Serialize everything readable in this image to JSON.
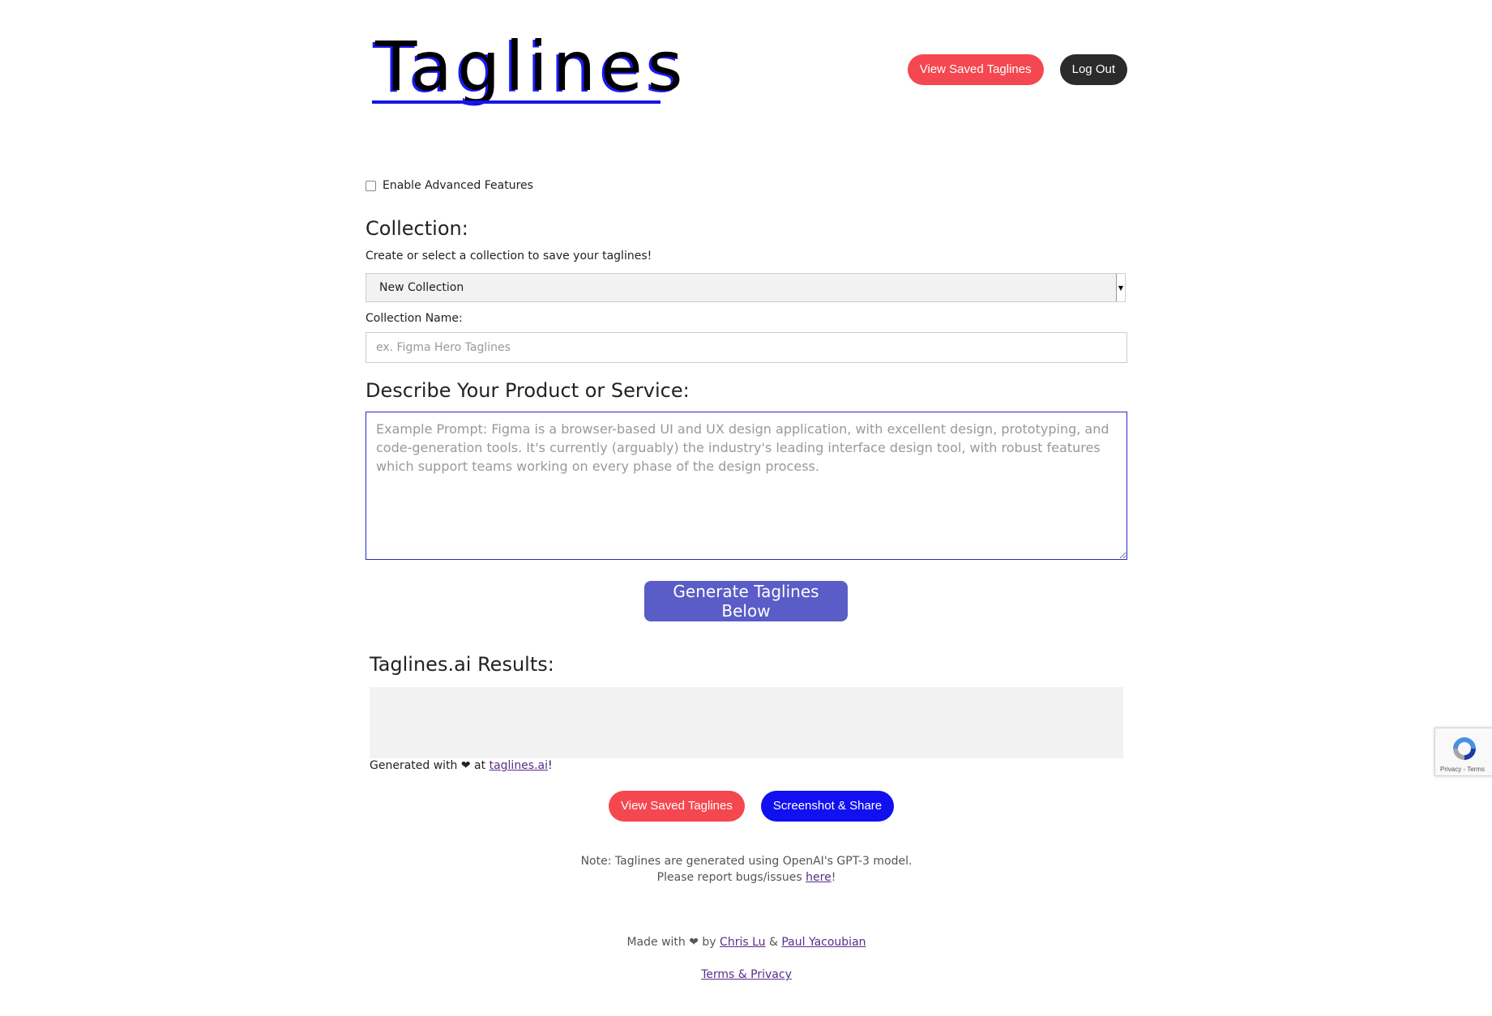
{
  "header": {
    "logo_text": "Taglines",
    "view_saved_label": "View Saved Taglines",
    "logout_label": "Log Out"
  },
  "advanced": {
    "label": "Enable Advanced Features"
  },
  "collection": {
    "title": "Collection:",
    "help": "Create or select a collection to save your taglines!",
    "selected": "New Collection",
    "name_label": "Collection Name:",
    "name_placeholder": "ex. Figma Hero Taglines"
  },
  "describe": {
    "title": "Describe Your Product or Service:",
    "placeholder": "Example Prompt: Figma is a browser-based UI and UX design application, with excellent design, prototyping, and code-generation tools. It's currently (arguably) the industry's leading interface design tool, with robust features which support teams working on every phase of the design process."
  },
  "generate_label": "Generate Taglines Below",
  "results": {
    "title": "Taglines.ai Results:",
    "generated_prefix": "Generated with ❤ at ",
    "generated_link": "taglines.ai",
    "generated_suffix": "!"
  },
  "bottom": {
    "view_saved_label": "View Saved Taglines",
    "share_label": "Screenshot & Share"
  },
  "note": {
    "line1": "Note: Taglines are generated using OpenAI's GPT-3 model.",
    "line2_prefix": "Please report bugs/issues ",
    "line2_link": "here",
    "line2_suffix": "!"
  },
  "footer": {
    "made_prefix": "Made with ❤ by ",
    "author1": "Chris Lu",
    "amp": " & ",
    "author2": "Paul Yacoubian",
    "terms": "Terms & Privacy"
  },
  "recaptcha": {
    "terms": "Privacy - Terms"
  },
  "colors": {
    "red": "#f5474f",
    "dark": "#2b2b2b",
    "blue": "#1010f0",
    "purple_button": "#5a5cc7",
    "logo_blue": "#1515e6"
  }
}
